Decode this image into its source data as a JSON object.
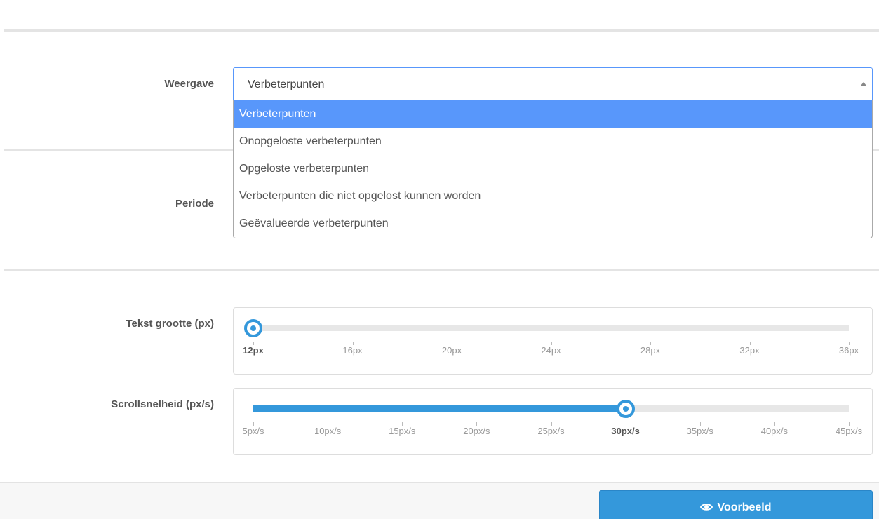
{
  "form": {
    "weergave": {
      "label": "Weergave",
      "selected": "Verbeterpunten",
      "options": [
        "Verbeterpunten",
        "Onopgeloste verbeterpunten",
        "Opgeloste verbeterpunten",
        "Verbeterpunten die niet opgelost kunnen worden",
        "Geëvalueerde verbeterpunten"
      ],
      "active_index": 0
    },
    "periode": {
      "label": "Periode"
    },
    "text_size": {
      "label": "Tekst grootte (px)",
      "ticks": [
        "12px",
        "16px",
        "20px",
        "24px",
        "28px",
        "32px",
        "36px"
      ],
      "value_index": 0
    },
    "scroll_speed": {
      "label": "Scrollsnelheid (px/s)",
      "ticks": [
        "5px/s",
        "10px/s",
        "15px/s",
        "20px/s",
        "25px/s",
        "30px/s",
        "35px/s",
        "40px/s",
        "45px/s"
      ],
      "value_index": 5
    }
  },
  "footer": {
    "preview_label": "Voorbeeld",
    "preview_icon": "eye-icon"
  },
  "colors": {
    "accent": "#3498db",
    "select_highlight": "#5897fb"
  }
}
